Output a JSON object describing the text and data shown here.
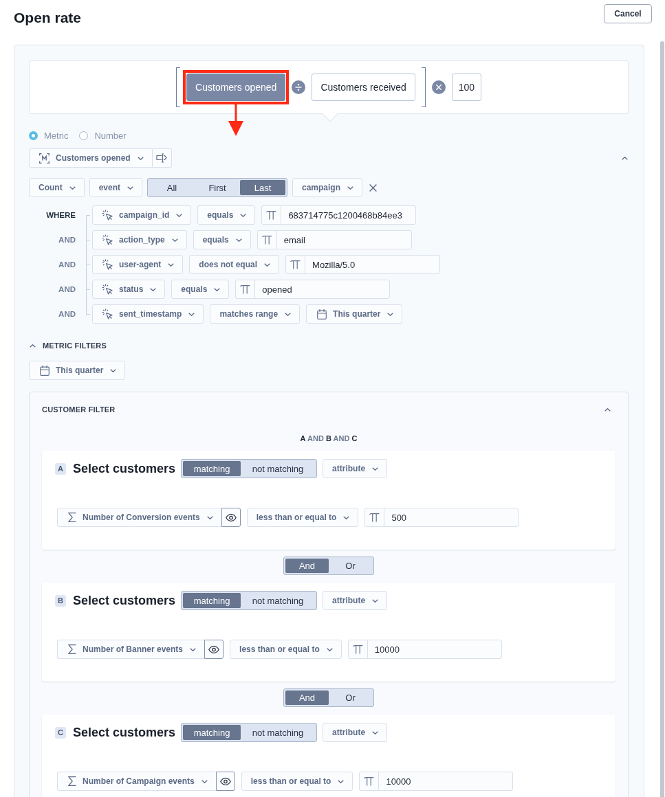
{
  "header": {
    "title": "Open rate",
    "cancel": "Cancel"
  },
  "formula": {
    "group": [
      {
        "kind": "term",
        "label": "Customers opened",
        "selected": true,
        "highlighted": true
      },
      {
        "kind": "divide"
      },
      {
        "kind": "term",
        "label": "Customers received",
        "selected": false,
        "highlighted": false
      }
    ],
    "multiplier": "100"
  },
  "source": [
    {
      "label": "Metric",
      "selected": true
    },
    {
      "label": "Number",
      "selected": false
    }
  ],
  "metric": {
    "label": "Customers opened",
    "expanded": true
  },
  "aggregation": {
    "function": "Count",
    "subject": "event",
    "occurrence": [
      {
        "label": "All",
        "selected": false
      },
      {
        "label": "First",
        "selected": false
      },
      {
        "label": "Last",
        "selected": true
      }
    ],
    "property": "campaign"
  },
  "conditions": [
    {
      "connector": "WHERE",
      "field": "campaign_id",
      "operator": "equals",
      "kind": "text",
      "value": "683714775c1200468b84ee3"
    },
    {
      "connector": "AND",
      "field": "action_type",
      "operator": "equals",
      "kind": "text",
      "value": "email"
    },
    {
      "connector": "AND",
      "field": "user-agent",
      "operator": "does not equal",
      "kind": "text",
      "value": "Mozilla/5.0"
    },
    {
      "connector": "AND",
      "field": "status",
      "operator": "equals",
      "kind": "text",
      "value": "opened"
    },
    {
      "connector": "AND",
      "field": "sent_timestamp",
      "operator": "matches range",
      "kind": "date",
      "value": "This quarter"
    }
  ],
  "metric_filters": {
    "title": "METRIC FILTERS",
    "expanded": true,
    "date_range": "This quarter"
  },
  "customer_filter": {
    "title": "CUSTOMER FILTER",
    "expanded": true,
    "summary": "**A** AND **B** AND **C**",
    "groups": [
      {
        "letter": "A",
        "title": "Select customers",
        "match": [
          {
            "label": "matching",
            "selected": true
          },
          {
            "label": "not matching",
            "selected": false
          }
        ],
        "type": "attribute",
        "condition": {
          "field": "Number of Conversion events",
          "operator": "less than or equal to",
          "value": "500"
        },
        "join": [
          {
            "label": "And",
            "selected": true
          },
          {
            "label": "Or",
            "selected": false
          }
        ]
      },
      {
        "letter": "B",
        "title": "Select customers",
        "match": [
          {
            "label": "matching",
            "selected": true
          },
          {
            "label": "not matching",
            "selected": false
          }
        ],
        "type": "attribute",
        "condition": {
          "field": "Number of Banner events",
          "operator": "less than or equal to",
          "value": "10000"
        },
        "join": [
          {
            "label": "And",
            "selected": true
          },
          {
            "label": "Or",
            "selected": false
          }
        ]
      },
      {
        "letter": "C",
        "title": "Select customers",
        "match": [
          {
            "label": "matching",
            "selected": true
          },
          {
            "label": "not matching",
            "selected": false
          }
        ],
        "type": "attribute",
        "condition": {
          "field": "Number of Campaign events",
          "operator": "less than or equal to",
          "value": "10000"
        }
      }
    ]
  }
}
